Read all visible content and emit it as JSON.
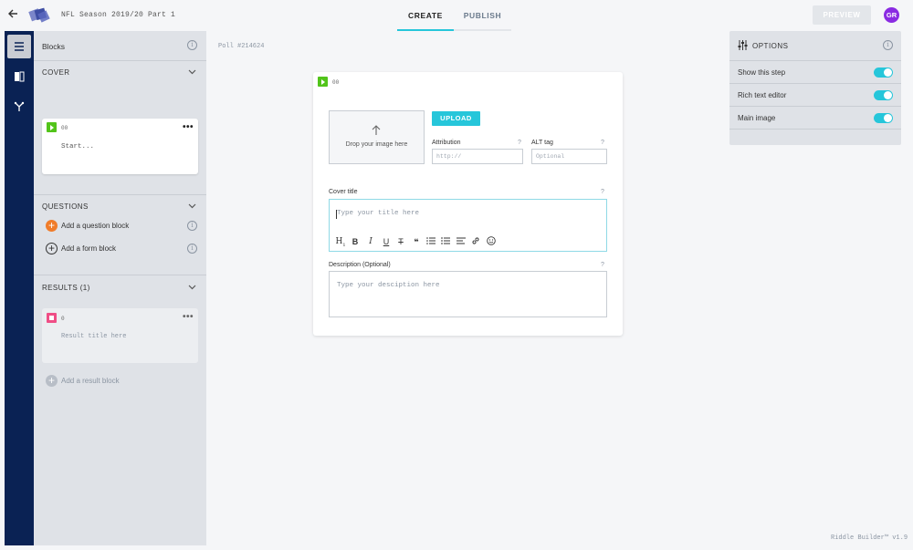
{
  "header": {
    "doc_title": "NFL Season 2019/20 Part 1",
    "tabs": [
      {
        "label": "CREATE"
      },
      {
        "label": "PUBLISH"
      }
    ],
    "preview_label": "PREVIEW",
    "avatar_initials": "GR"
  },
  "sidebar": {
    "title": "Blocks",
    "cover": {
      "heading": "COVER",
      "card": {
        "num": "00",
        "text": "Start..."
      }
    },
    "questions": {
      "heading": "QUESTIONS",
      "add_question": "Add a question block",
      "add_form": "Add a form block"
    },
    "results": {
      "heading": "RESULTS (1)",
      "card": {
        "num": "0",
        "text": "Result title here"
      },
      "add_result": "Add a result block"
    }
  },
  "editor": {
    "poll_id": "Poll #214624",
    "block_num": "00",
    "drop_text": "Drop your image here",
    "upload_label": "UPLOAD",
    "attribution_label": "Attribution",
    "attribution_placeholder": "http://",
    "alt_label": "ALT tag",
    "alt_placeholder": "Optional",
    "help": "?",
    "cover_title_label": "Cover title",
    "cover_title_placeholder": "Type your title here",
    "description_label": "Description (Optional)",
    "description_placeholder": "Type your desciption here",
    "toolbar": {
      "heading": "H",
      "bold": "B",
      "italic": "I",
      "underline": "U",
      "strike": "T",
      "quote": "❝"
    }
  },
  "options": {
    "title": "OPTIONS",
    "rows": [
      {
        "label": "Show this step",
        "on": true
      },
      {
        "label": "Rich text editor",
        "on": true
      },
      {
        "label": "Main image",
        "on": true
      }
    ]
  },
  "footer": {
    "version": "Riddle Builder™ v1.9"
  },
  "colors": {
    "accent": "#26c6da",
    "rail": "#0a2254",
    "avatar": "#8a2be2",
    "question_add": "#f07c2a",
    "result_badge": "#ef4e86",
    "cover_badge": "#52c41a"
  }
}
